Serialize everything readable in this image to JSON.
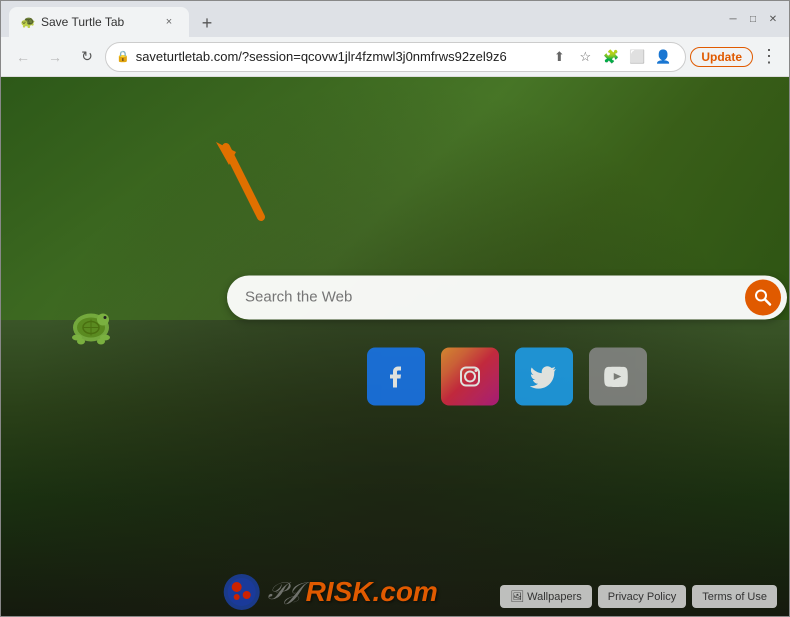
{
  "browser": {
    "tab": {
      "title": "Save Turtle Tab",
      "favicon": "🐢",
      "close_label": "×"
    },
    "new_tab_label": "+",
    "window_controls": {
      "minimize": "─",
      "maximize": "□",
      "close": "✕"
    },
    "nav": {
      "back_label": "←",
      "forward_label": "→",
      "reload_label": "↻",
      "address": "saveturtletab.com/?session=qcovw1jlr4fzmwl3j0nmfrws92zel9z6",
      "share_label": "⬆",
      "bookmark_label": "☆",
      "extensions_label": "🧩",
      "split_label": "⬜",
      "profile_label": "👤",
      "update_label": "Update",
      "menu_label": "⋮"
    }
  },
  "page": {
    "search": {
      "placeholder": "Search the Web",
      "button_icon": "🔍"
    },
    "social_icons": [
      {
        "name": "Facebook",
        "type": "facebook"
      },
      {
        "name": "Instagram",
        "type": "instagram"
      },
      {
        "name": "Twitter",
        "type": "twitter"
      },
      {
        "name": "YouTube",
        "type": "youtube"
      }
    ],
    "bottom": {
      "risk_prefix": "𝒫𝒥",
      "risk_text": "RISK.com",
      "wallpapers_label": "🖼 Wallpapers",
      "privacy_label": "Privacy Policy",
      "terms_label": "Terms of Use"
    }
  }
}
